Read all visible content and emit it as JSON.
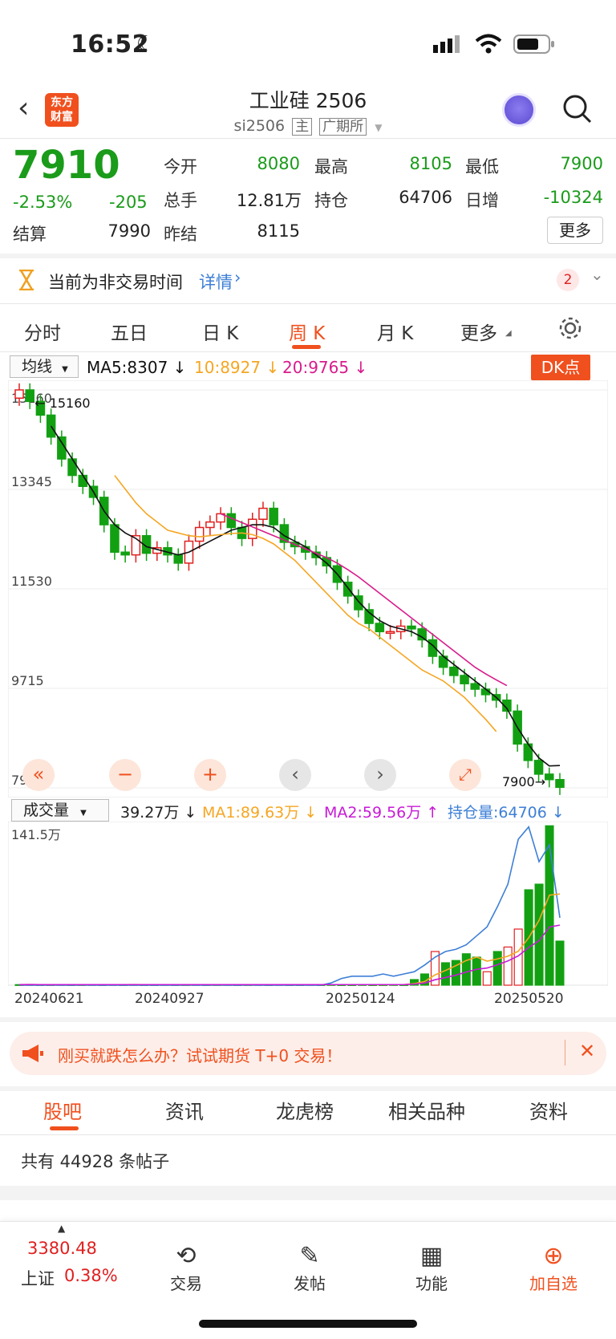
{
  "status": {
    "time": "16:52"
  },
  "header": {
    "title": "工业硅 2506",
    "code": "si2506",
    "tag_main": "主",
    "exchange": "广期所",
    "logo_line1": "东方",
    "logo_line2": "财富"
  },
  "quote": {
    "price": "7910",
    "change_pct": "-2.53%",
    "change": "-205",
    "open_label": "今开",
    "open": "8080",
    "high_label": "最高",
    "high": "8105",
    "low_label": "最低",
    "low": "7900",
    "volume_label": "总手",
    "volume": "12.81万",
    "oi_label": "持仓",
    "oi": "64706",
    "daily_inc_label": "日增",
    "daily_inc": "-10324",
    "settle_label": "结算",
    "settle": "7990",
    "prev_settle_label": "昨结",
    "prev_settle": "8115",
    "more": "更多"
  },
  "notice": {
    "text": "当前为非交易时间",
    "link": "详情",
    "count": "2"
  },
  "tabs": [
    "分时",
    "五日",
    "日 K",
    "周 K",
    "月 K",
    "更多"
  ],
  "chart": {
    "indicator_select": "均线",
    "ma5": "MA5:8307",
    "ma10": "10:8927",
    "ma20": "20:9765",
    "dk_button": "DK点",
    "price_ticks": [
      "15160",
      "13345",
      "11530",
      "9715",
      "7900"
    ],
    "high_marker": "15160",
    "low_marker": "7900",
    "volume_select": "成交量",
    "vol_value": "39.27万",
    "vol_ma1": "MA1:89.63万",
    "vol_ma2": "MA2:59.56万",
    "vol_oi": "持仓量:64706",
    "vol_max": "141.5万",
    "dates": [
      "20240621",
      "20240927",
      "20250124",
      "20250520"
    ],
    "colors": {
      "up": "#e02020",
      "down": "#12a012",
      "ma5": "#111111",
      "ma10": "#f5a623",
      "ma20": "#d81b8c",
      "oi": "#3d7fd6"
    }
  },
  "chart_data": {
    "type": "candlestick",
    "ylim": [
      7900,
      15160
    ],
    "candles_close": [
      15160,
      14950,
      14700,
      14300,
      13900,
      13600,
      13400,
      13200,
      12700,
      12200,
      12150,
      12500,
      12180,
      12280,
      12150,
      12000,
      12400,
      12650,
      12750,
      12900,
      12650,
      12450,
      12800,
      13000,
      12700,
      12380,
      12300,
      12200,
      12100,
      11950,
      11650,
      11400,
      11150,
      10900,
      10750,
      10750,
      10850,
      10800,
      10600,
      10300,
      10100,
      9950,
      9800,
      9700,
      9600,
      9500,
      9300,
      8700,
      8400,
      8150,
      8050,
      7910
    ],
    "ma5": [
      15160,
      15000,
      14800,
      14500,
      14200,
      13900,
      13600,
      13300,
      12950,
      12700,
      12550,
      12450,
      12300,
      12250,
      12200,
      12150,
      12200,
      12300,
      12400,
      12500,
      12600,
      12650,
      12700,
      12700,
      12650,
      12500,
      12400,
      12300,
      12150,
      12000,
      11800,
      11550,
      11300,
      11100,
      10950,
      10850,
      10800,
      10750,
      10650,
      10500,
      10300,
      10150,
      10000,
      9850,
      9700,
      9550,
      9350,
      9000,
      8700,
      8450,
      8300,
      8307
    ],
    "ma10_start": 9,
    "ma10": [
      13600,
      13350,
      13100,
      12900,
      12750,
      12600,
      12550,
      12500,
      12480,
      12500,
      12520,
      12540,
      12550,
      12520,
      12450,
      12350,
      12200,
      12050,
      11850,
      11650,
      11450,
      11250,
      11050,
      10900,
      10800,
      10650,
      10500,
      10350,
      10200,
      10050,
      9950,
      9850,
      9700,
      9550,
      9350,
      9150,
      8927
    ],
    "ma20_start": 19,
    "ma20": [
      12900,
      12820,
      12740,
      12660,
      12580,
      12500,
      12420,
      12340,
      12260,
      12180,
      12100,
      12000,
      11880,
      11750,
      11600,
      11450,
      11300,
      11150,
      11000,
      10850,
      10700,
      10550,
      10400,
      10250,
      10100,
      9980,
      9870,
      9765
    ],
    "volume_max": 141.5,
    "volume_wan": [
      0.5,
      0.6,
      0.5,
      0.5,
      0.6,
      0.5,
      0.5,
      0.6,
      0.5,
      0.6,
      0.5,
      0.6,
      0.5,
      0.5,
      0.6,
      0.5,
      0.5,
      0.6,
      0.5,
      0.5,
      0.6,
      0.5,
      0.5,
      0.6,
      0.5,
      0.6,
      0.5,
      0.5,
      0.6,
      0.5,
      0.6,
      0.5,
      0.5,
      0.6,
      0.5,
      0.5,
      0.6,
      0.5,
      5,
      10,
      30,
      20,
      22,
      28,
      25,
      12,
      30,
      34,
      50,
      85,
      90,
      142,
      39.27
    ],
    "oi_curve": [
      0,
      0,
      0,
      0,
      0,
      0,
      0,
      0,
      0,
      0,
      0,
      0,
      0,
      0,
      0,
      0,
      0,
      0,
      0,
      0,
      0,
      0,
      0,
      0,
      0,
      0,
      0,
      0,
      0,
      0,
      2,
      6,
      8,
      8,
      8,
      10,
      8,
      10,
      12,
      18,
      25,
      30,
      32,
      36,
      44,
      52,
      70,
      90,
      130,
      141,
      110,
      125,
      60
    ]
  },
  "promo": {
    "text": "刚买就跌怎么办？试试期货 T+0 交易！"
  },
  "bottom_tabs": [
    "股吧",
    "资讯",
    "龙虎榜",
    "相关品种",
    "资料"
  ],
  "post_count": "共有 44928 条帖子",
  "navbar": {
    "index_value": "3380.48",
    "index_name": "上证",
    "index_pct": "0.38%",
    "items": [
      "交易",
      "发帖",
      "功能",
      "加自选"
    ]
  }
}
